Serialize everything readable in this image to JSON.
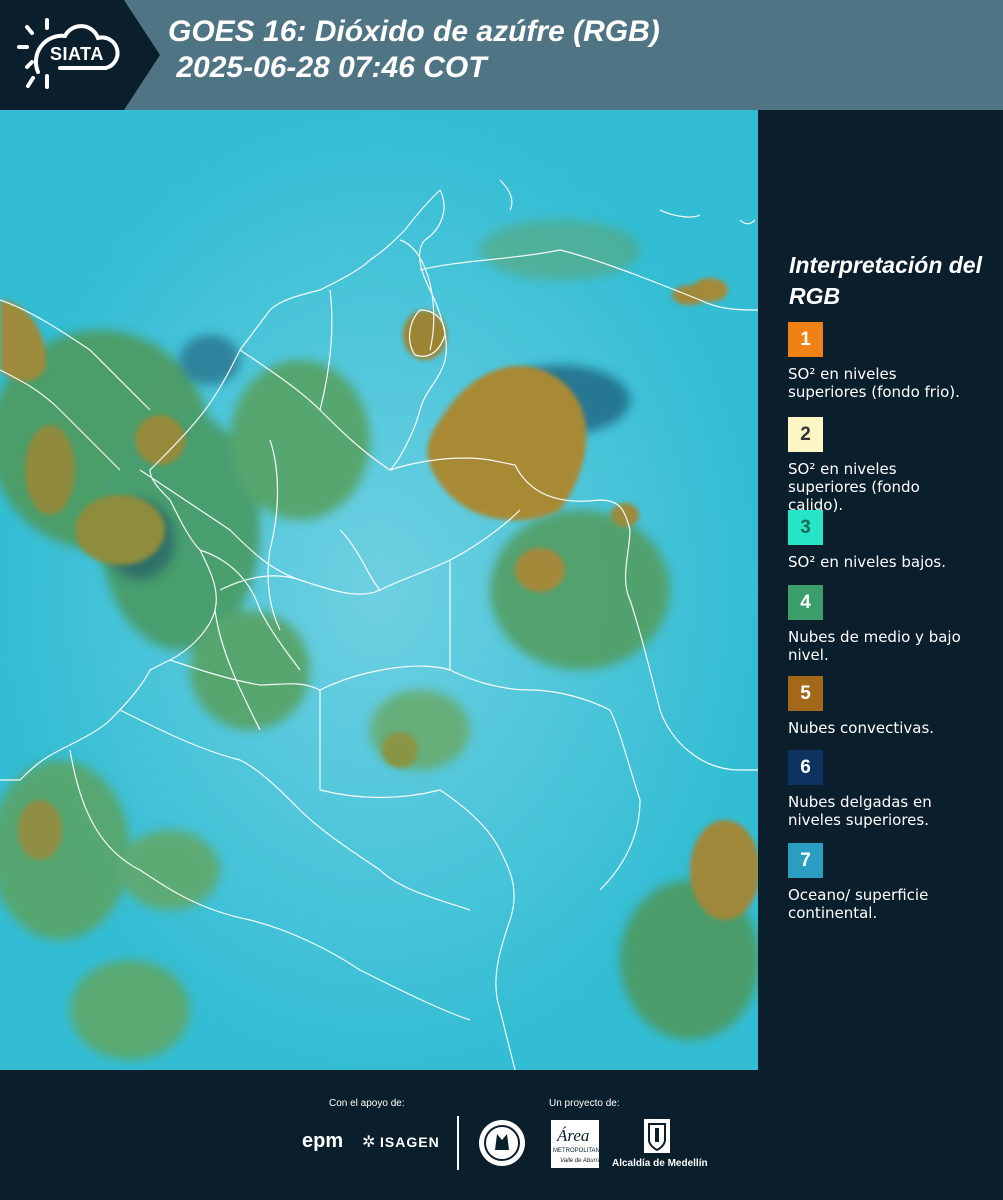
{
  "header": {
    "logo_text": "SIATA",
    "title": "GOES 16: Dióxido de azúfre (RGB)\n 2025-06-28 07:46 COT"
  },
  "map": {
    "background_color": "#33bdd4",
    "cloud_colors": [
      "#a88a35",
      "#4f9a5d",
      "#7a8f3a"
    ],
    "border_color": "#ffffff"
  },
  "legend": {
    "title": "Interpretación del RGB",
    "items": [
      {
        "number": "1",
        "color": "#f08114",
        "text_color": "#ffffff",
        "description": "SO² en niveles superiores (fondo frio)."
      },
      {
        "number": "2",
        "color": "#fdf6c4",
        "text_color": "#333333",
        "description": "SO² en niveles superiores (fondo calido)."
      },
      {
        "number": "3",
        "color": "#27e6c7",
        "text_color": "#1d6a5b",
        "description": "SO² en niveles bajos."
      },
      {
        "number": "4",
        "color": "#3c9e6a",
        "text_color": "#ffffff",
        "description": "Nubes de medio y bajo nivel."
      },
      {
        "number": "5",
        "color": "#a3681a",
        "text_color": "#ffffff",
        "description": "Nubes convectivas."
      },
      {
        "number": "6",
        "color": "#0e3360",
        "text_color": "#ffffff",
        "description": "Nubes delgadas en niveles superiores."
      },
      {
        "number": "7",
        "color": "#2a9ec2",
        "text_color": "#ffffff",
        "description": "Oceano/ superficie continental."
      }
    ]
  },
  "footer": {
    "support_label": "Con el apoyo de:",
    "project_label": "Un proyecto de:",
    "epm": "epm",
    "isagen": "ISAGEN",
    "area_metro": "Área",
    "area_metro_sub": "METROPOLITANA",
    "area_metro_sub2": "Valle de Aburrá",
    "alcaldia": "Alcaldía de Medellín"
  }
}
